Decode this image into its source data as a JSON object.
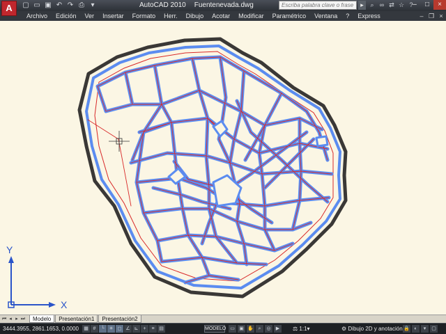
{
  "title_bar": {
    "app_logo": "A",
    "app_name": "AutoCAD 2010",
    "file_name": "Fuentenevada.dwg",
    "search_placeholder": "Escriba palabra clave o frase",
    "quick_access_icons": [
      "new-icon",
      "open-icon",
      "save-icon",
      "undo-icon",
      "redo-icon",
      "plot-icon",
      "dropdown-icon"
    ],
    "right_icons": [
      "search-icon",
      "binoculars-icon",
      "exchange-icon",
      "star-icon",
      "help-icon"
    ]
  },
  "menu": {
    "items": [
      "Archivo",
      "Edición",
      "Ver",
      "Insertar",
      "Formato",
      "Herr.",
      "Dibujo",
      "Acotar",
      "Modificar",
      "Paramétrico",
      "Ventana",
      "?",
      "Express"
    ]
  },
  "ucs": {
    "x_label": "X",
    "y_label": "Y"
  },
  "layout_tabs": {
    "tabs": [
      {
        "label": "Modelo",
        "active": true
      },
      {
        "label": "Presentación1",
        "active": false
      },
      {
        "label": "Presentación2",
        "active": false
      }
    ]
  },
  "status_bar": {
    "coordinates": "3444.3955, 2861.1653, 0.0000",
    "space": "MODELO",
    "annotation_scale": "1:1",
    "workspace": "Dibujo 2D y anotación"
  },
  "colors": {
    "drawing_background": "#fbf6e4",
    "outer_boundary": "#3a3836",
    "street_blue": "#5b8cf0",
    "street_red": "#d82828",
    "ucs": "#2a54c9"
  }
}
